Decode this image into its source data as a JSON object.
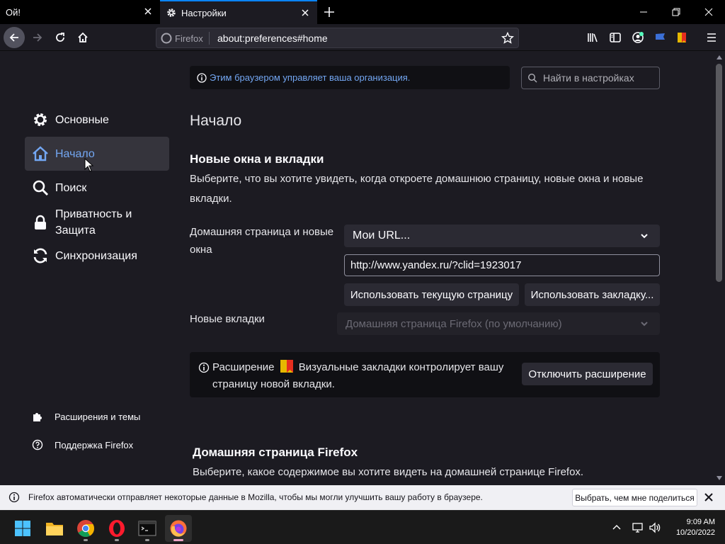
{
  "tabs": [
    {
      "title": "Ой!",
      "active": false
    },
    {
      "title": "Настройки",
      "active": true
    }
  ],
  "urlbar": {
    "identity": "Firefox",
    "url": "about:preferences#home"
  },
  "managed_notice": "Этим браузером управляет ваша организация.",
  "search": {
    "placeholder": "Найти в настройках"
  },
  "sidebar": {
    "items": [
      {
        "label": "Основные",
        "icon": "gear-icon"
      },
      {
        "label": "Начало",
        "icon": "home-icon",
        "selected": true
      },
      {
        "label": "Поиск",
        "icon": "search-icon"
      },
      {
        "label": "Приватность и Защита",
        "icon": "lock-icon"
      },
      {
        "label": "Синхронизация",
        "icon": "sync-icon"
      }
    ],
    "bottom": [
      {
        "label": "Расширения и темы",
        "icon": "puzzle-icon"
      },
      {
        "label": "Поддержка Firefox",
        "icon": "help-icon"
      }
    ]
  },
  "main": {
    "page_title": "Начало",
    "section1": {
      "title": "Новые окна и вкладки",
      "description": "Выберите, что вы хотите увидеть, когда откроете домашнюю страницу, новые окна и новые вкладки.",
      "homepage_label": "Домашняя страница и новые окна",
      "homepage_select": "Мои URL...",
      "homepage_url": "http://www.yandex.ru/?clid=1923017",
      "use_current_button": "Использовать текущую страницу",
      "use_bookmark_button": "Использовать закладку...",
      "newtabs_label": "Новые вкладки",
      "newtabs_select": "Домашняя страница Firefox (по умолчанию)"
    },
    "extension_notice": {
      "prefix": "Расширение",
      "suffix": "Визуальные закладки контролирует вашу страницу новой вкладки.",
      "disable_button": "Отключить расширение"
    },
    "section2": {
      "title": "Домашняя страница Firefox",
      "description": "Выберите, какое содержимое вы хотите видеть на домашней странице Firefox."
    }
  },
  "notification": {
    "text": "Firefox автоматически отправляет некоторые данные в Mozilla, чтобы мы могли улучшить вашу работу в браузере.",
    "button": "Выбрать, чем мне поделиться"
  },
  "taskbar": {
    "apps": [
      "start-icon",
      "file-explorer-icon",
      "chrome-icon",
      "opera-icon",
      "terminal-icon",
      "firefox-icon"
    ],
    "time": "9:09 AM",
    "date": "10/20/2022"
  },
  "colors": {
    "accent": "#0a84ff",
    "link": "#73a7f3",
    "background": "#1c1b22"
  }
}
